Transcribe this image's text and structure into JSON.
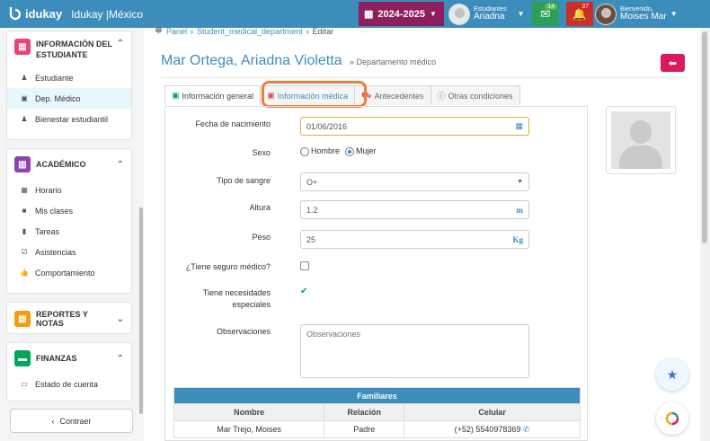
{
  "topbar": {
    "brand": "idukay",
    "app_title": "Idukay |México",
    "year": "2024-2025",
    "student": {
      "role": "Estudiantes",
      "name": "Ariadna"
    },
    "messages_count": "14",
    "notifications_count": "37",
    "user": {
      "greeting": "Bienvenido,",
      "name": "Moises Mar"
    }
  },
  "sidebar": {
    "student_section": {
      "title": "INFORMACIÓN DEL ESTUDIANTE",
      "items": [
        {
          "label": "Estudiante",
          "icon": "person-icon"
        },
        {
          "label": "Dep. Médico",
          "icon": "medkit-icon"
        },
        {
          "label": "Bienestar estudiantil",
          "icon": "person-icon"
        }
      ]
    },
    "academic_section": {
      "title": "ACADÉMICO",
      "items": [
        {
          "label": "Horario",
          "icon": "calendar-icon"
        },
        {
          "label": "Mis clases",
          "icon": "folder-icon"
        },
        {
          "label": "Tareas",
          "icon": "book-icon"
        },
        {
          "label": "Asistencias",
          "icon": "check-icon"
        },
        {
          "label": "Comportamiento",
          "icon": "thumbs-up-icon"
        }
      ]
    },
    "reports_section": {
      "title": "REPORTES Y NOTAS"
    },
    "finance_section": {
      "title": "FINANZAS",
      "items": [
        {
          "label": "Estado de cuenta",
          "icon": "card-icon"
        }
      ]
    },
    "collapse_label": "Contraer"
  },
  "breadcrumb": {
    "home": "Panel",
    "section": "Student_medical_department",
    "current": "Editar"
  },
  "page": {
    "title": "Mar Ortega, Ariadna Violetta",
    "subtitle": "» Departamento médico"
  },
  "tabs": [
    {
      "label": "Información general"
    },
    {
      "label": "Información médica"
    },
    {
      "label": "Antecedentes"
    },
    {
      "label": "Otras condiciones"
    }
  ],
  "form": {
    "birth_label": "Fecha de nacimiento",
    "birth_value": "01/06/2016",
    "sex_label": "Sexo",
    "sex_male": "Hombre",
    "sex_female": "Mujer",
    "blood_label": "Tipo de sangre",
    "blood_value": "O+",
    "height_label": "Altura",
    "height_value": "1.2",
    "height_unit": "m",
    "weight_label": "Peso",
    "weight_value": "25",
    "weight_unit": "Kg",
    "insurance_label": "¿Tiene seguro médico?",
    "special_needs_label_1": "Tiene necesidades",
    "special_needs_label_2": "especiales",
    "observations_label": "Observaciones",
    "observations_placeholder": "Observaciones"
  },
  "family_table": {
    "title": "Familiares",
    "headers": [
      "Nombre",
      "Relación",
      "Celular"
    ],
    "rows": [
      [
        "Mar Trejo, Moises",
        "Padre",
        "(+52) 5540978369"
      ]
    ]
  },
  "colors": {
    "primary": "#3c8dbc",
    "accent": "#d81b60",
    "year_bg": "#8e1f5e",
    "highlight": "#f07d3b"
  }
}
